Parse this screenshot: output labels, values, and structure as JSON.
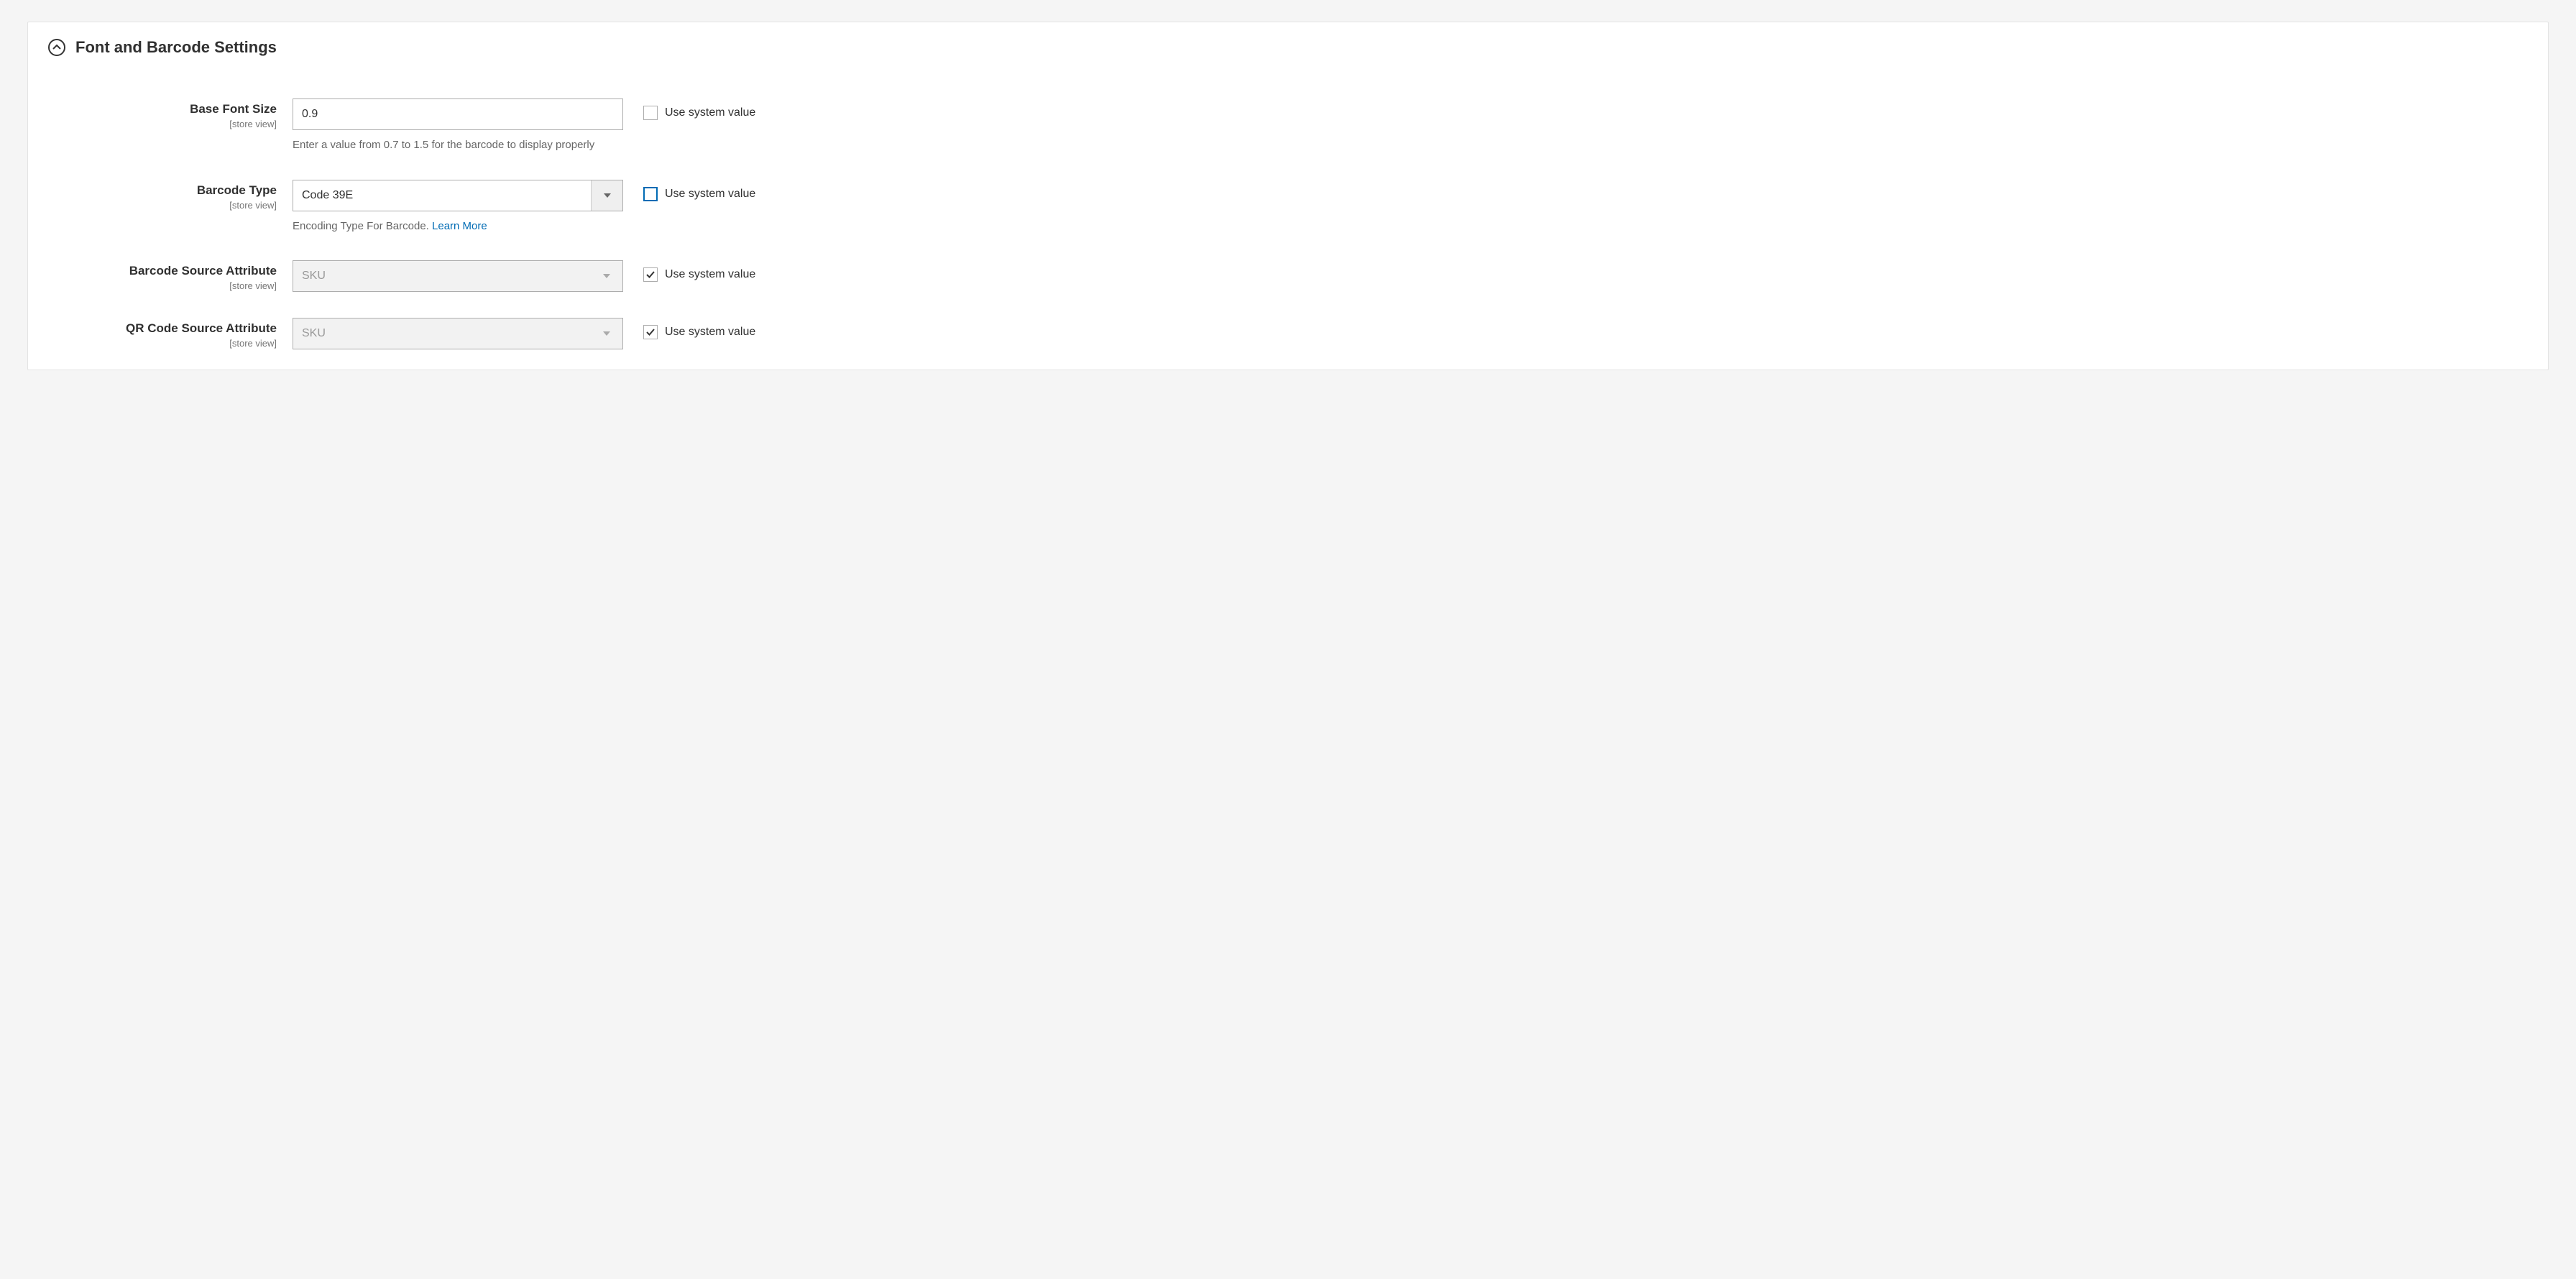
{
  "section": {
    "title": "Font and Barcode Settings"
  },
  "labels": {
    "scope": "[store view]",
    "use_system": "Use system value"
  },
  "fields": {
    "font_size": {
      "label": "Base Font Size",
      "value": "0.9",
      "hint": "Enter a value from 0.7 to 1.5 for the barcode to display properly",
      "use_system": false,
      "focused": false
    },
    "barcode_type": {
      "label": "Barcode Type",
      "value": "Code 39E",
      "hint_prefix": "Encoding Type For Barcode. ",
      "hint_link": "Learn More",
      "use_system": false,
      "focused": true,
      "disabled": false
    },
    "barcode_source": {
      "label": "Barcode Source Attribute",
      "value": "SKU",
      "use_system": true,
      "focused": false,
      "disabled": true
    },
    "qr_source": {
      "label": "QR Code Source Attribute",
      "value": "SKU",
      "use_system": true,
      "focused": false,
      "disabled": true
    }
  }
}
